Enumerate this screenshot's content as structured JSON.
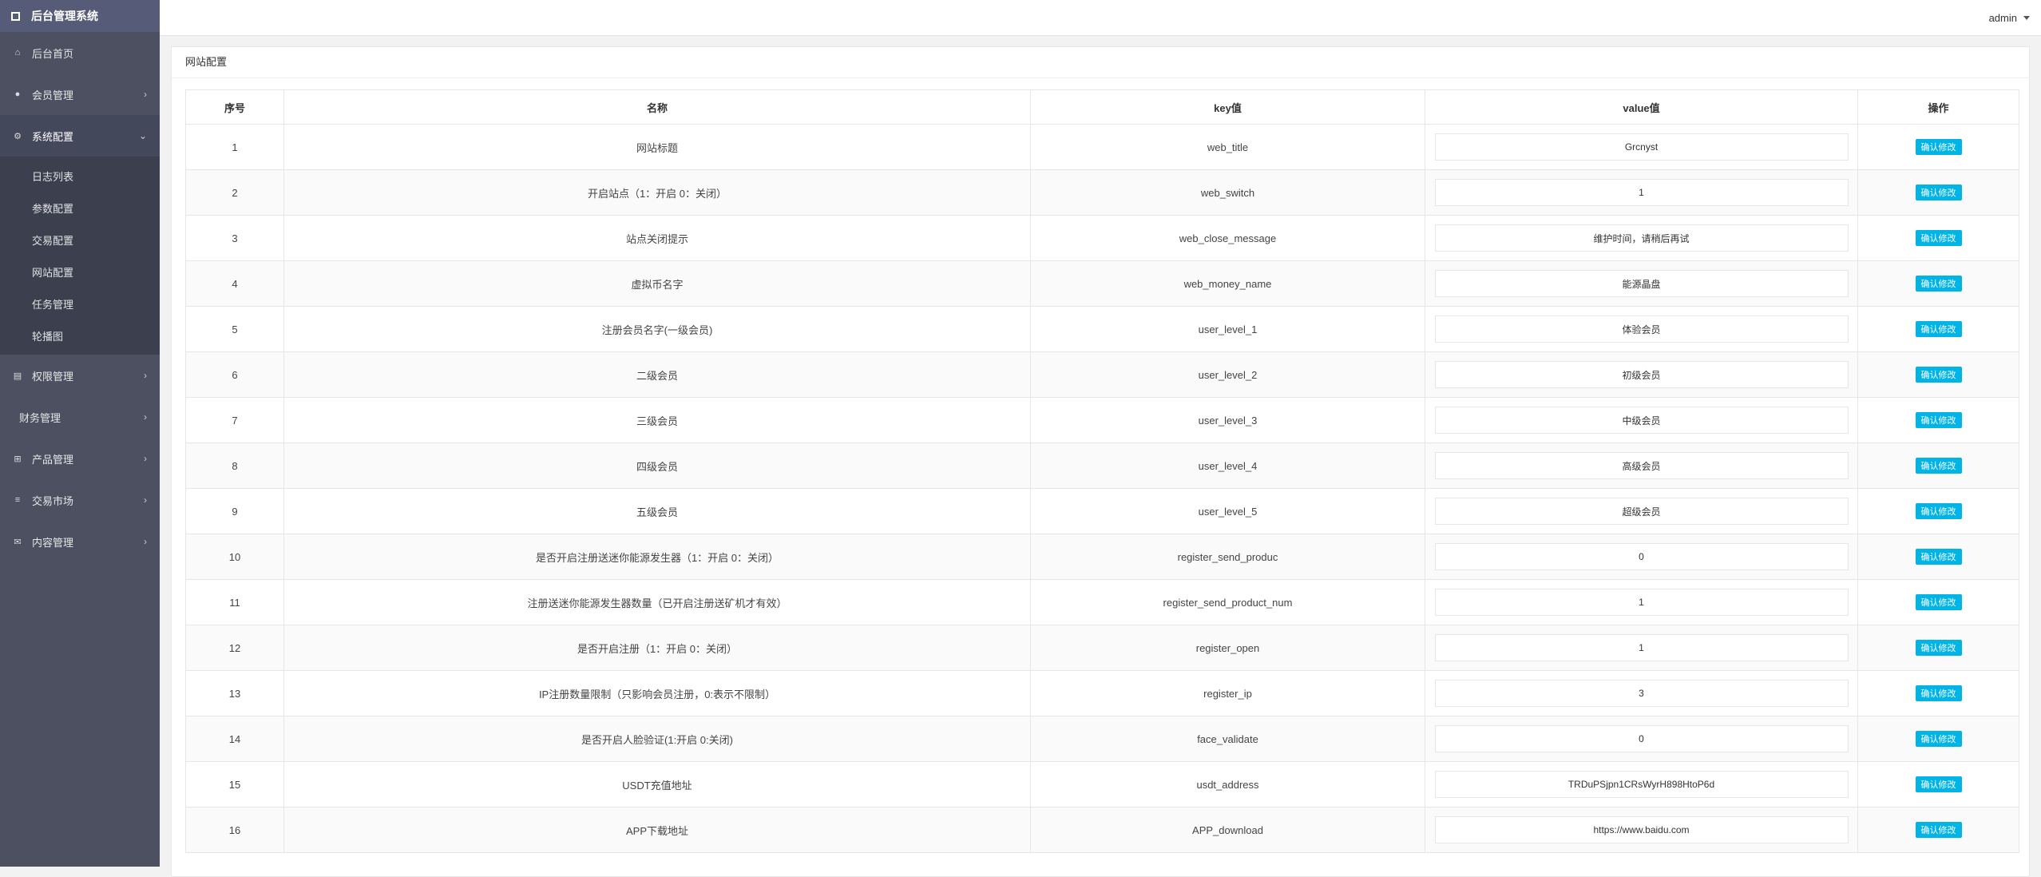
{
  "app": {
    "title": "后台管理系统"
  },
  "user": {
    "name": "admin"
  },
  "sidebar": {
    "items": [
      {
        "label": "后台首页",
        "icon": "home-icon",
        "glyph": "⌂",
        "has_children": false
      },
      {
        "label": "会员管理",
        "icon": "user-icon",
        "glyph": "●",
        "has_children": true
      },
      {
        "label": "系统配置",
        "icon": "gears-icon",
        "glyph": "⚙",
        "has_children": true,
        "expanded": true,
        "children": [
          "日志列表",
          "参数配置",
          "交易配置",
          "网站配置",
          "任务管理",
          "轮播图"
        ]
      },
      {
        "label": "权限管理",
        "icon": "list-alt-icon",
        "glyph": "▤",
        "has_children": true
      },
      {
        "label": "财务管理",
        "icon": "",
        "glyph": "",
        "has_children": true
      },
      {
        "label": "产品管理",
        "icon": "windows-icon",
        "glyph": "⊞",
        "has_children": true
      },
      {
        "label": "交易市场",
        "icon": "bars-icon",
        "glyph": "≡",
        "has_children": true
      },
      {
        "label": "内容管理",
        "icon": "envelope-icon",
        "glyph": "✉",
        "has_children": true
      }
    ]
  },
  "panel": {
    "title": "网站配置"
  },
  "table": {
    "headers": [
      "序号",
      "名称",
      "key值",
      "value值",
      "操作"
    ],
    "button_label": "确认修改",
    "rows": [
      {
        "no": "1",
        "name": "网站标题",
        "key": "web_title",
        "value": "Grcnyst"
      },
      {
        "no": "2",
        "name": "开启站点（1：开启 0：关闭）",
        "key": "web_switch",
        "value": "1"
      },
      {
        "no": "3",
        "name": "站点关闭提示",
        "key": "web_close_message",
        "value": "维护时间，请稍后再试"
      },
      {
        "no": "4",
        "name": "虚拟币名字",
        "key": "web_money_name",
        "value": "能源晶盘"
      },
      {
        "no": "5",
        "name": "注册会员名字(一级会员)",
        "key": "user_level_1",
        "value": "体验会员"
      },
      {
        "no": "6",
        "name": "二级会员",
        "key": "user_level_2",
        "value": "初级会员"
      },
      {
        "no": "7",
        "name": "三级会员",
        "key": "user_level_3",
        "value": "中级会员"
      },
      {
        "no": "8",
        "name": "四级会员",
        "key": "user_level_4",
        "value": "高级会员"
      },
      {
        "no": "9",
        "name": "五级会员",
        "key": "user_level_5",
        "value": "超级会员"
      },
      {
        "no": "10",
        "name": "是否开启注册送迷你能源发生器（1：开启 0：关闭）",
        "key": "register_send_produc",
        "value": "0"
      },
      {
        "no": "11",
        "name": "注册送迷你能源发生器数量（已开启注册送矿机才有效）",
        "key": "register_send_product_num",
        "value": "1"
      },
      {
        "no": "12",
        "name": "是否开启注册（1：开启 0：关闭）",
        "key": "register_open",
        "value": "1"
      },
      {
        "no": "13",
        "name": "IP注册数量限制（只影响会员注册，0:表示不限制）",
        "key": "register_ip",
        "value": "3"
      },
      {
        "no": "14",
        "name": "是否开启人脸验证(1:开启 0:关闭)",
        "key": "face_validate",
        "value": "0"
      },
      {
        "no": "15",
        "name": "USDT充值地址",
        "key": "usdt_address",
        "value": "TRDuPSjpn1CRsWyrH898HtoP6d"
      },
      {
        "no": "16",
        "name": "APP下载地址",
        "key": "APP_download",
        "value": "https://www.baidu.com"
      }
    ]
  },
  "colors": {
    "sidebar": "#4c5061",
    "brand": "#565c78",
    "button": "#00b4e6"
  }
}
